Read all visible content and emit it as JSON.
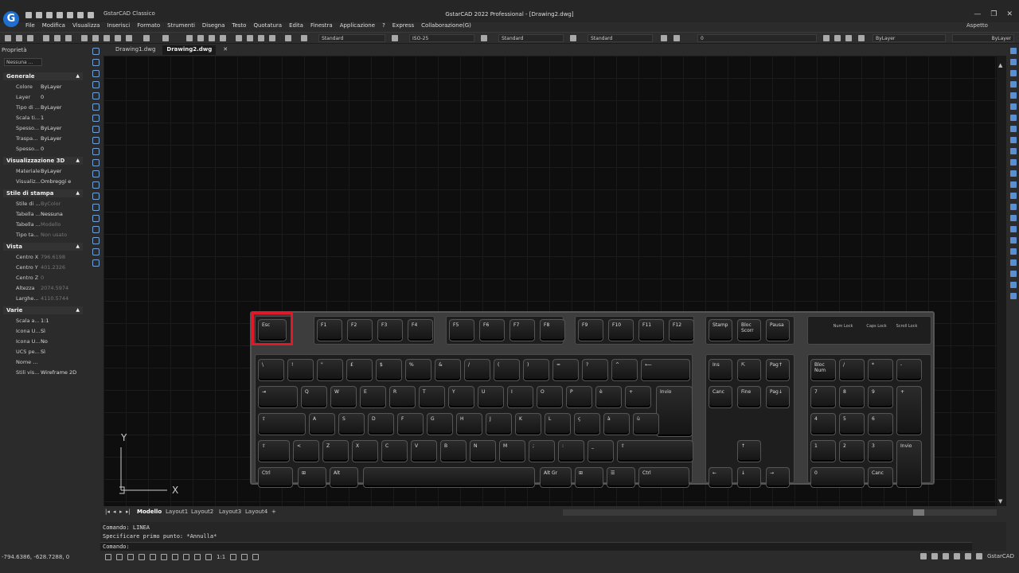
{
  "app": {
    "logo_letter": "G",
    "workspace": "GstarCAD Classico",
    "title": "GstarCAD 2022 Professional - [Drawing2.dwg]",
    "aspect": "Aspetto",
    "min_glyph": "—",
    "restore_glyph": "❐",
    "close_glyph": "✕"
  },
  "menu": [
    "File",
    "Modifica",
    "Visualizza",
    "Inserisci",
    "Formato",
    "Strumenti",
    "Disegna",
    "Testo",
    "Quotatura",
    "Edita",
    "Finestra",
    "Applicazione",
    "?",
    "Express",
    "Collaborazione(G)"
  ],
  "toolbar": {
    "text_style": "Standard",
    "dim_style": "ISO-25",
    "table_style": "Standard",
    "multileader_style": "Standard",
    "layer_value": "0",
    "color_value": "ByLayer",
    "linetype_value": "ByLayer"
  },
  "properties": {
    "title": "Proprietà",
    "selection": "Nessuna ...",
    "sections": [
      {
        "name": "Generale",
        "rows": [
          {
            "k": "Colore",
            "v": "ByLayer"
          },
          {
            "k": "Layer",
            "v": "0"
          },
          {
            "k": "Tipo di ...",
            "v": "ByLayer"
          },
          {
            "k": "Scala ti...",
            "v": "1"
          },
          {
            "k": "Spesso...",
            "v": "ByLayer"
          },
          {
            "k": "Traspa...",
            "v": "ByLayer"
          },
          {
            "k": "Spesso...",
            "v": "0"
          }
        ]
      },
      {
        "name": "Visualizzazione 3D",
        "rows": [
          {
            "k": "Materiale",
            "v": "ByLayer"
          },
          {
            "k": "Visualiz...",
            "v": "Ombreggi e rice..."
          }
        ]
      },
      {
        "name": "Stile di stampa",
        "rows": [
          {
            "k": "Stile di ...",
            "v": "ByColor"
          },
          {
            "k": "Tabella ...",
            "v": "Nessuna"
          },
          {
            "k": "Tabella ...",
            "v": "Modello"
          },
          {
            "k": "Tipo ta...",
            "v": "Non usato"
          }
        ]
      },
      {
        "name": "Vista",
        "rows": [
          {
            "k": "Centro X",
            "v": "796.6198"
          },
          {
            "k": "Centro Y",
            "v": "401.2326"
          },
          {
            "k": "Centro Z",
            "v": "0"
          },
          {
            "k": "Altezza",
            "v": "2074.5974"
          },
          {
            "k": "Larghe...",
            "v": "4110.5744"
          }
        ]
      },
      {
        "name": "Varie",
        "rows": [
          {
            "k": "Scala a...",
            "v": "1:1"
          },
          {
            "k": "Icona U...",
            "v": "Sì"
          },
          {
            "k": "Icona U...",
            "v": "No"
          },
          {
            "k": "UCS pe...",
            "v": "Sì"
          },
          {
            "k": "Nome ...",
            "v": ""
          },
          {
            "k": "Stili vis...",
            "v": "Wireframe 2D"
          }
        ]
      }
    ]
  },
  "doc_tabs": [
    {
      "label": "Drawing1.dwg",
      "active": false
    },
    {
      "label": "Drawing2.dwg",
      "active": true
    }
  ],
  "doc_tab_close": "✕",
  "layout_tabs": [
    "Modello",
    "Layout1",
    "Layout2",
    "Layout3",
    "Layout4",
    "+"
  ],
  "command": {
    "lines": [
      "Comando: LINEA",
      "Specificare primo punto:  *Annulla*"
    ],
    "prompt": "Comando:"
  },
  "status": {
    "coords": "-794.6386, -628.7288, 0",
    "scale": "1:1",
    "brand": "GstarCAD"
  },
  "ucs": {
    "y_label": "Y",
    "x_label": "X"
  },
  "keyboard": {
    "esc": "Esc",
    "f_keys": [
      "F1",
      "F2",
      "F3",
      "F4",
      "F5",
      "F6",
      "F7",
      "F8",
      "F9",
      "F10",
      "F11",
      "F12"
    ],
    "sys_keys": [
      "Stamp",
      "Bloc Scorr",
      "Pausa"
    ],
    "leds": [
      "Num Lock",
      "Caps Lock",
      "Scroll Lock"
    ],
    "row_numbers": [
      "\\",
      "!",
      "\"",
      "£",
      "$",
      "%",
      "&",
      "/",
      "(",
      ")",
      "=",
      "?",
      "^"
    ],
    "row_q": [
      "Q",
      "W",
      "E",
      "R",
      "T",
      "Y",
      "U",
      "I",
      "O",
      "P",
      "è",
      "+"
    ],
    "row_a": [
      "A",
      "S",
      "D",
      "F",
      "G",
      "H",
      "J",
      "K",
      "L",
      "ç",
      "à",
      "ù"
    ],
    "row_z": [
      "<",
      "Z",
      "X",
      "C",
      "V",
      "B",
      "N",
      "M",
      ";",
      ":",
      "_"
    ],
    "tab": "⇥",
    "caps": "⇪",
    "shift": "⇧",
    "backspace": "⟵",
    "enter": "Invio",
    "ctrl": "Ctrl",
    "alt": "Alt",
    "altgr": "Alt Gr",
    "win": "⊞",
    "menu_key": "☰",
    "ins": "Ins",
    "home": "⇱",
    "pgup": "Pag↑",
    "canc": "Canc",
    "fine": "Fine",
    "pgdn": "Pag↓",
    "arrows": [
      "↑",
      "←",
      "↓",
      "→"
    ],
    "numpad": [
      "Bloc Num",
      "/",
      "*",
      "-",
      "7",
      "8",
      "9",
      "+",
      "4",
      "5",
      "6",
      "1",
      "2",
      "3",
      "Invio",
      "0",
      "Canc"
    ]
  }
}
